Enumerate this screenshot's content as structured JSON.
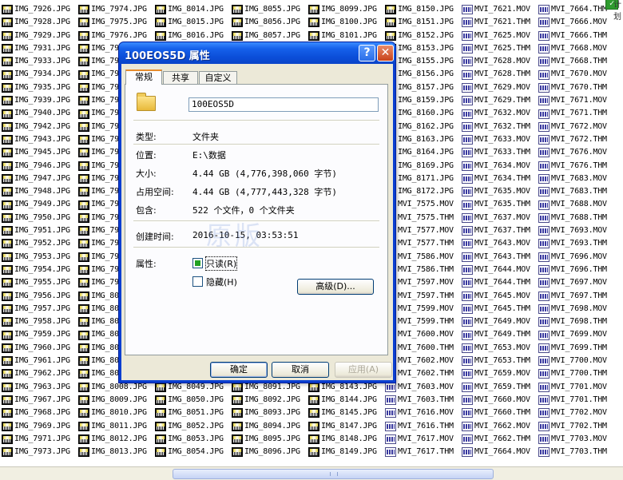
{
  "file_columns": [
    [
      "IMG_7926.JPG",
      "IMG_7928.JPG",
      "IMG_7929.JPG",
      "IMG_7931.JPG",
      "IMG_7933.JPG",
      "IMG_7934.JPG",
      "IMG_7935.JPG",
      "IMG_7939.JPG",
      "IMG_7940.JPG",
      "IMG_7942.JPG",
      "IMG_7943.JPG",
      "IMG_7945.JPG",
      "IMG_7946.JPG",
      "IMG_7947.JPG",
      "IMG_7948.JPG",
      "IMG_7949.JPG",
      "IMG_7950.JPG",
      "IMG_7951.JPG",
      "IMG_7952.JPG",
      "IMG_7953.JPG",
      "IMG_7954.JPG",
      "IMG_7955.JPG",
      "IMG_7956.JPG",
      "IMG_7957.JPG",
      "IMG_7958.JPG",
      "IMG_7959.JPG",
      "IMG_7960.JPG",
      "IMG_7961.JPG",
      "IMG_7962.JPG",
      "IMG_7963.JPG",
      "IMG_7967.JPG",
      "IMG_7968.JPG",
      "IMG_7969.JPG",
      "IMG_7971.JPG",
      "IMG_7973.JPG"
    ],
    [
      "IMG_7974.JPG",
      "IMG_7975.JPG",
      "IMG_7976.JPG",
      "IMG_79",
      "IMG_79",
      "IMG_79",
      "IMG_79",
      "IMG_79",
      "IMG_79",
      "IMG_79",
      "IMG_79",
      "IMG_79",
      "IMG_79",
      "IMG_79",
      "IMG_79",
      "IMG_79",
      "IMG_79",
      "IMG_79",
      "IMG_79",
      "IMG_79",
      "IMG_79",
      "IMG_79",
      "IMG_80",
      "IMG_80",
      "IMG_80",
      "IMG_80",
      "IMG_80",
      "IMG_80",
      "IMG_80",
      "IMG_8008.JPG",
      "IMG_8009.JPG",
      "IMG_8010.JPG",
      "IMG_8011.JPG",
      "IMG_8012.JPG",
      "IMG_8013.JPG"
    ],
    [
      "IMG_8014.JPG",
      "IMG_8015.JPG",
      "IMG_8016.JPG",
      "",
      "",
      "",
      "",
      "",
      "",
      "",
      "",
      "",
      "",
      "",
      "",
      "",
      "",
      "",
      "",
      "",
      "",
      "",
      "",
      "",
      "",
      "",
      "",
      "",
      "",
      "IMG_8049.JPG",
      "IMG_8050.JPG",
      "IMG_8051.JPG",
      "IMG_8052.JPG",
      "IMG_8053.JPG",
      "IMG_8054.JPG"
    ],
    [
      "IMG_8055.JPG",
      "IMG_8056.JPG",
      "IMG_8057.JPG",
      "",
      "",
      "",
      "",
      "",
      "",
      "",
      "",
      "",
      "",
      "",
      "",
      "",
      "",
      "",
      "",
      "",
      "",
      "",
      "",
      "",
      "",
      "",
      "",
      "",
      "",
      "IMG_8091.JPG",
      "IMG_8092.JPG",
      "IMG_8093.JPG",
      "IMG_8094.JPG",
      "IMG_8095.JPG",
      "IMG_8096.JPG"
    ],
    [
      "IMG_8099.JPG",
      "IMG_8100.JPG",
      "IMG_8101.JPG",
      "",
      "",
      "",
      "",
      "",
      "",
      "",
      "",
      "",
      "",
      "",
      "",
      "",
      "",
      "",
      "",
      "",
      "",
      "",
      "",
      "",
      "",
      "",
      "",
      "",
      "",
      "IMG_8143.JPG",
      "IMG_8144.JPG",
      "IMG_8145.JPG",
      "IMG_8147.JPG",
      "IMG_8148.JPG",
      "IMG_8149.JPG"
    ],
    [
      "IMG_8150.JPG",
      "IMG_8151.JPG",
      "IMG_8152.JPG",
      "IMG_8153.JPG",
      "IMG_8155.JPG",
      "IMG_8156.JPG",
      "IMG_8157.JPG",
      "IMG_8159.JPG",
      "IMG_8160.JPG",
      "IMG_8162.JPG",
      "IMG_8163.JPG",
      "IMG_8164.JPG",
      "IMG_8169.JPG",
      "IMG_8171.JPG",
      "IMG_8172.JPG",
      "MVI_7575.MOV",
      "MVI_7575.THM",
      "MVI_7577.MOV",
      "MVI_7577.THM",
      "MVI_7586.MOV",
      "MVI_7586.THM",
      "MVI_7597.MOV",
      "MVI_7597.THM",
      "MVI_7599.MOV",
      "MVI_7599.THM",
      "MVI_7600.MOV",
      "MVI_7600.THM",
      "MVI_7602.MOV",
      "MVI_7602.THM",
      "MVI_7603.MOV",
      "MVI_7603.THM",
      "MVI_7616.MOV",
      "MVI_7616.THM",
      "MVI_7617.MOV",
      "MVI_7617.THM"
    ],
    [
      "MVI_7621.MOV",
      "MVI_7621.THM",
      "MVI_7625.MOV",
      "MVI_7625.THM",
      "MVI_7628.MOV",
      "MVI_7628.THM",
      "MVI_7629.MOV",
      "MVI_7629.THM",
      "MVI_7632.MOV",
      "MVI_7632.THM",
      "MVI_7633.MOV",
      "MVI_7633.THM",
      "MVI_7634.MOV",
      "MVI_7634.THM",
      "MVI_7635.MOV",
      "MVI_7635.THM",
      "MVI_7637.MOV",
      "MVI_7637.THM",
      "MVI_7643.MOV",
      "MVI_7643.THM",
      "MVI_7644.MOV",
      "MVI_7644.THM",
      "MVI_7645.MOV",
      "MVI_7645.THM",
      "MVI_7649.MOV",
      "MVI_7649.THM",
      "MVI_7653.MOV",
      "MVI_7653.THM",
      "MVI_7659.MOV",
      "MVI_7659.THM",
      "MVI_7660.MOV",
      "MVI_7660.THM",
      "MVI_7662.MOV",
      "MVI_7662.THM",
      "MVI_7664.MOV"
    ],
    [
      "MVI_7664.THM",
      "MVI_7666.MOV",
      "MVI_7666.THM",
      "MVI_7668.MOV",
      "MVI_7668.THM",
      "MVI_7670.MOV",
      "MVI_7670.THM",
      "MVI_7671.MOV",
      "MVI_7671.THM",
      "MVI_7672.MOV",
      "MVI_7672.THM",
      "MVI_7676.MOV",
      "MVI_7676.THM",
      "MVI_7683.MOV",
      "MVI_7683.THM",
      "MVI_7688.MOV",
      "MVI_7688.THM",
      "MVI_7693.MOV",
      "MVI_7693.THM",
      "MVI_7696.MOV",
      "MVI_7696.THM",
      "MVI_7697.MOV",
      "MVI_7697.THM",
      "MVI_7698.MOV",
      "MVI_7698.THM",
      "MVI_7699.MOV",
      "MVI_7699.THM",
      "MVI_7700.MOV",
      "MVI_7700.THM",
      "MVI_7701.MOV",
      "MVI_7701.THM",
      "MVI_7702.MOV",
      "MVI_7702.THM",
      "MVI_7703.MOV",
      "MVI_7703.THM"
    ]
  ],
  "corner_label": "计划",
  "dialog": {
    "title": "100EOS5D 属性",
    "help_glyph": "?",
    "close_glyph": "✕",
    "tabs": [
      "常规",
      "共享",
      "自定义"
    ],
    "folder_name": "100EOS5D",
    "type_label": "类型:",
    "type_value": "文件夹",
    "location_label": "位置:",
    "location_value": "E:\\数据",
    "size_label": "大小:",
    "size_value": "4.44 GB (4,776,398,060 字节)",
    "size_on_disk_label": "占用空间:",
    "size_on_disk_value": "4.44 GB (4,777,443,328 字节)",
    "contains_label": "包含:",
    "contains_value": "522 个文件，0 个文件夹",
    "created_label": "创建时间:",
    "created_value": "2016-10-15, 03:53:51",
    "attributes_label": "属性:",
    "readonly_label": "只读(R)",
    "hidden_label": "隐藏(H)",
    "advanced_label": "高级(D)...",
    "ok_label": "确定",
    "cancel_label": "取消",
    "apply_label": "应用(A)",
    "watermark": "原版"
  }
}
